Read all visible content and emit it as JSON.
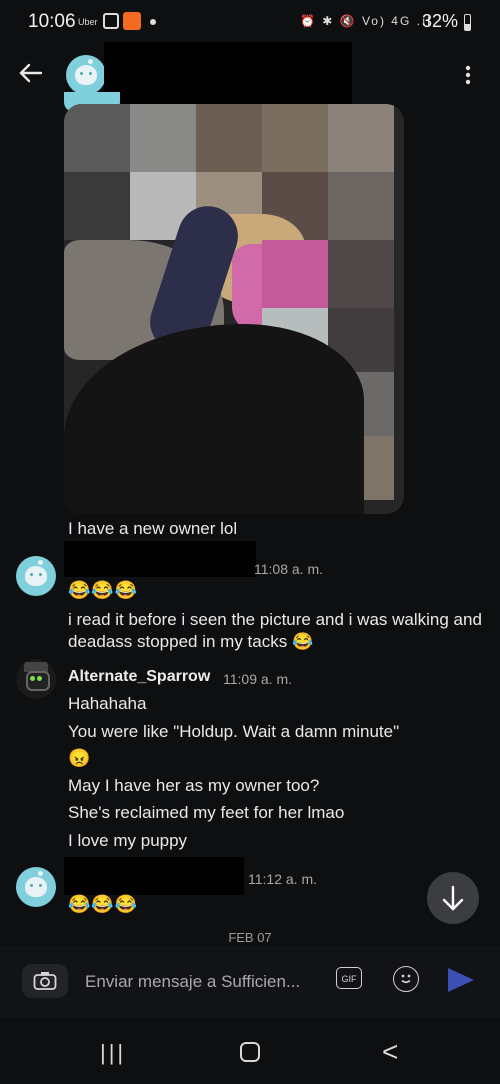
{
  "status_bar": {
    "time": "10:06",
    "uber": "Uber",
    "system_icons": "⏰ ✱ 🔇 Vo) 4G .ıl",
    "battery": "32%"
  },
  "header": {
    "back_icon": "arrow-left",
    "menu_icon": "more-vertical"
  },
  "messages": [
    {
      "id": "m1",
      "text": "I have a new owner lol"
    },
    {
      "id": "m2",
      "time": "11:08 a. m.",
      "emoji": "😂😂😂",
      "text": "i read it before i seen the picture and i was walking and deadass stopped in my tacks 😂"
    },
    {
      "id": "m3",
      "username": "Alternate_Sparrow",
      "time": "11:09 a. m.",
      "lines": [
        "Hahahaha",
        "You were like \"Holdup. Wait a damn minute\"",
        "😠",
        "May I have her as my owner too?",
        "She's reclaimed my feet for her lmao",
        "I love my puppy"
      ]
    },
    {
      "id": "m4",
      "time": "11:12 a. m.",
      "emoji": "😂😂😂"
    }
  ],
  "date_separator": "FEB 07",
  "composer": {
    "placeholder": "Enviar mensaje a Sufficien...",
    "gif_label": "GIF",
    "accent": "#3c4fb3"
  },
  "nav": {
    "recent": "|||",
    "back": "<"
  }
}
